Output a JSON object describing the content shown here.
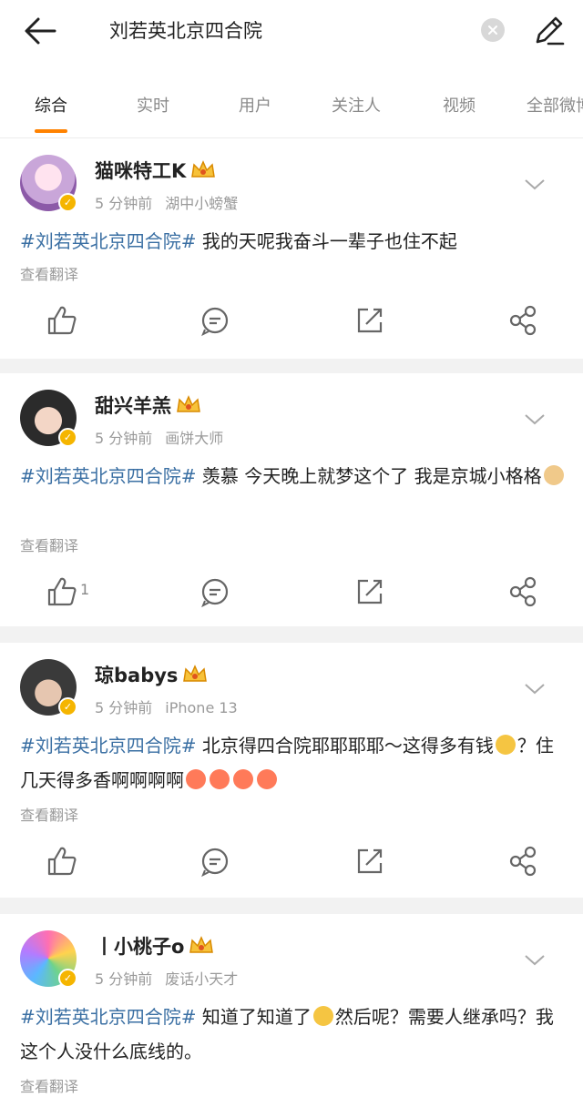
{
  "header": {
    "query": "刘若英北京四合院"
  },
  "tabs": [
    {
      "label": "综合"
    },
    {
      "label": "实时"
    },
    {
      "label": "用户"
    },
    {
      "label": "关注人"
    },
    {
      "label": "视频"
    },
    {
      "label": "全部微博"
    }
  ],
  "colors": {
    "accent": "#ff8200",
    "topic": "#3a6fa3",
    "badge": "#f5b500"
  },
  "posts": [
    {
      "user": "猫咪特工K",
      "time": "5 分钟前",
      "source": "湖中小螃蟹",
      "topic": "#刘若英北京四合院#",
      "text": " 我的天呢我奋斗一辈子也住不起",
      "translate": "查看翻译",
      "likes": ""
    },
    {
      "user": "甜兴羊羔",
      "time": "5 分钟前",
      "source": "画饼大师",
      "topic": "#刘若英北京四合院#",
      "text": " 羡慕 今天晚上就梦这个了 我是京城小格格",
      "translate": "查看翻译",
      "likes": "1"
    },
    {
      "user": "琼babys",
      "time": "5 分钟前",
      "source": "iPhone 13",
      "topic": "#刘若英北京四合院#",
      "text1": " 北京得四合院耶耶耶耶～这得多有钱",
      "text2": "？住几天得多香啊啊啊啊",
      "translate": "查看翻译",
      "likes": ""
    },
    {
      "user": "丨小桃子o",
      "time": "5 分钟前",
      "source": "废话小天才",
      "topic": "#刘若英北京四合院#",
      "text1": " 知道了知道了",
      "text2": "然后呢？需要人继承吗？我这个人没什么底线的。",
      "translate": "查看翻译"
    }
  ]
}
